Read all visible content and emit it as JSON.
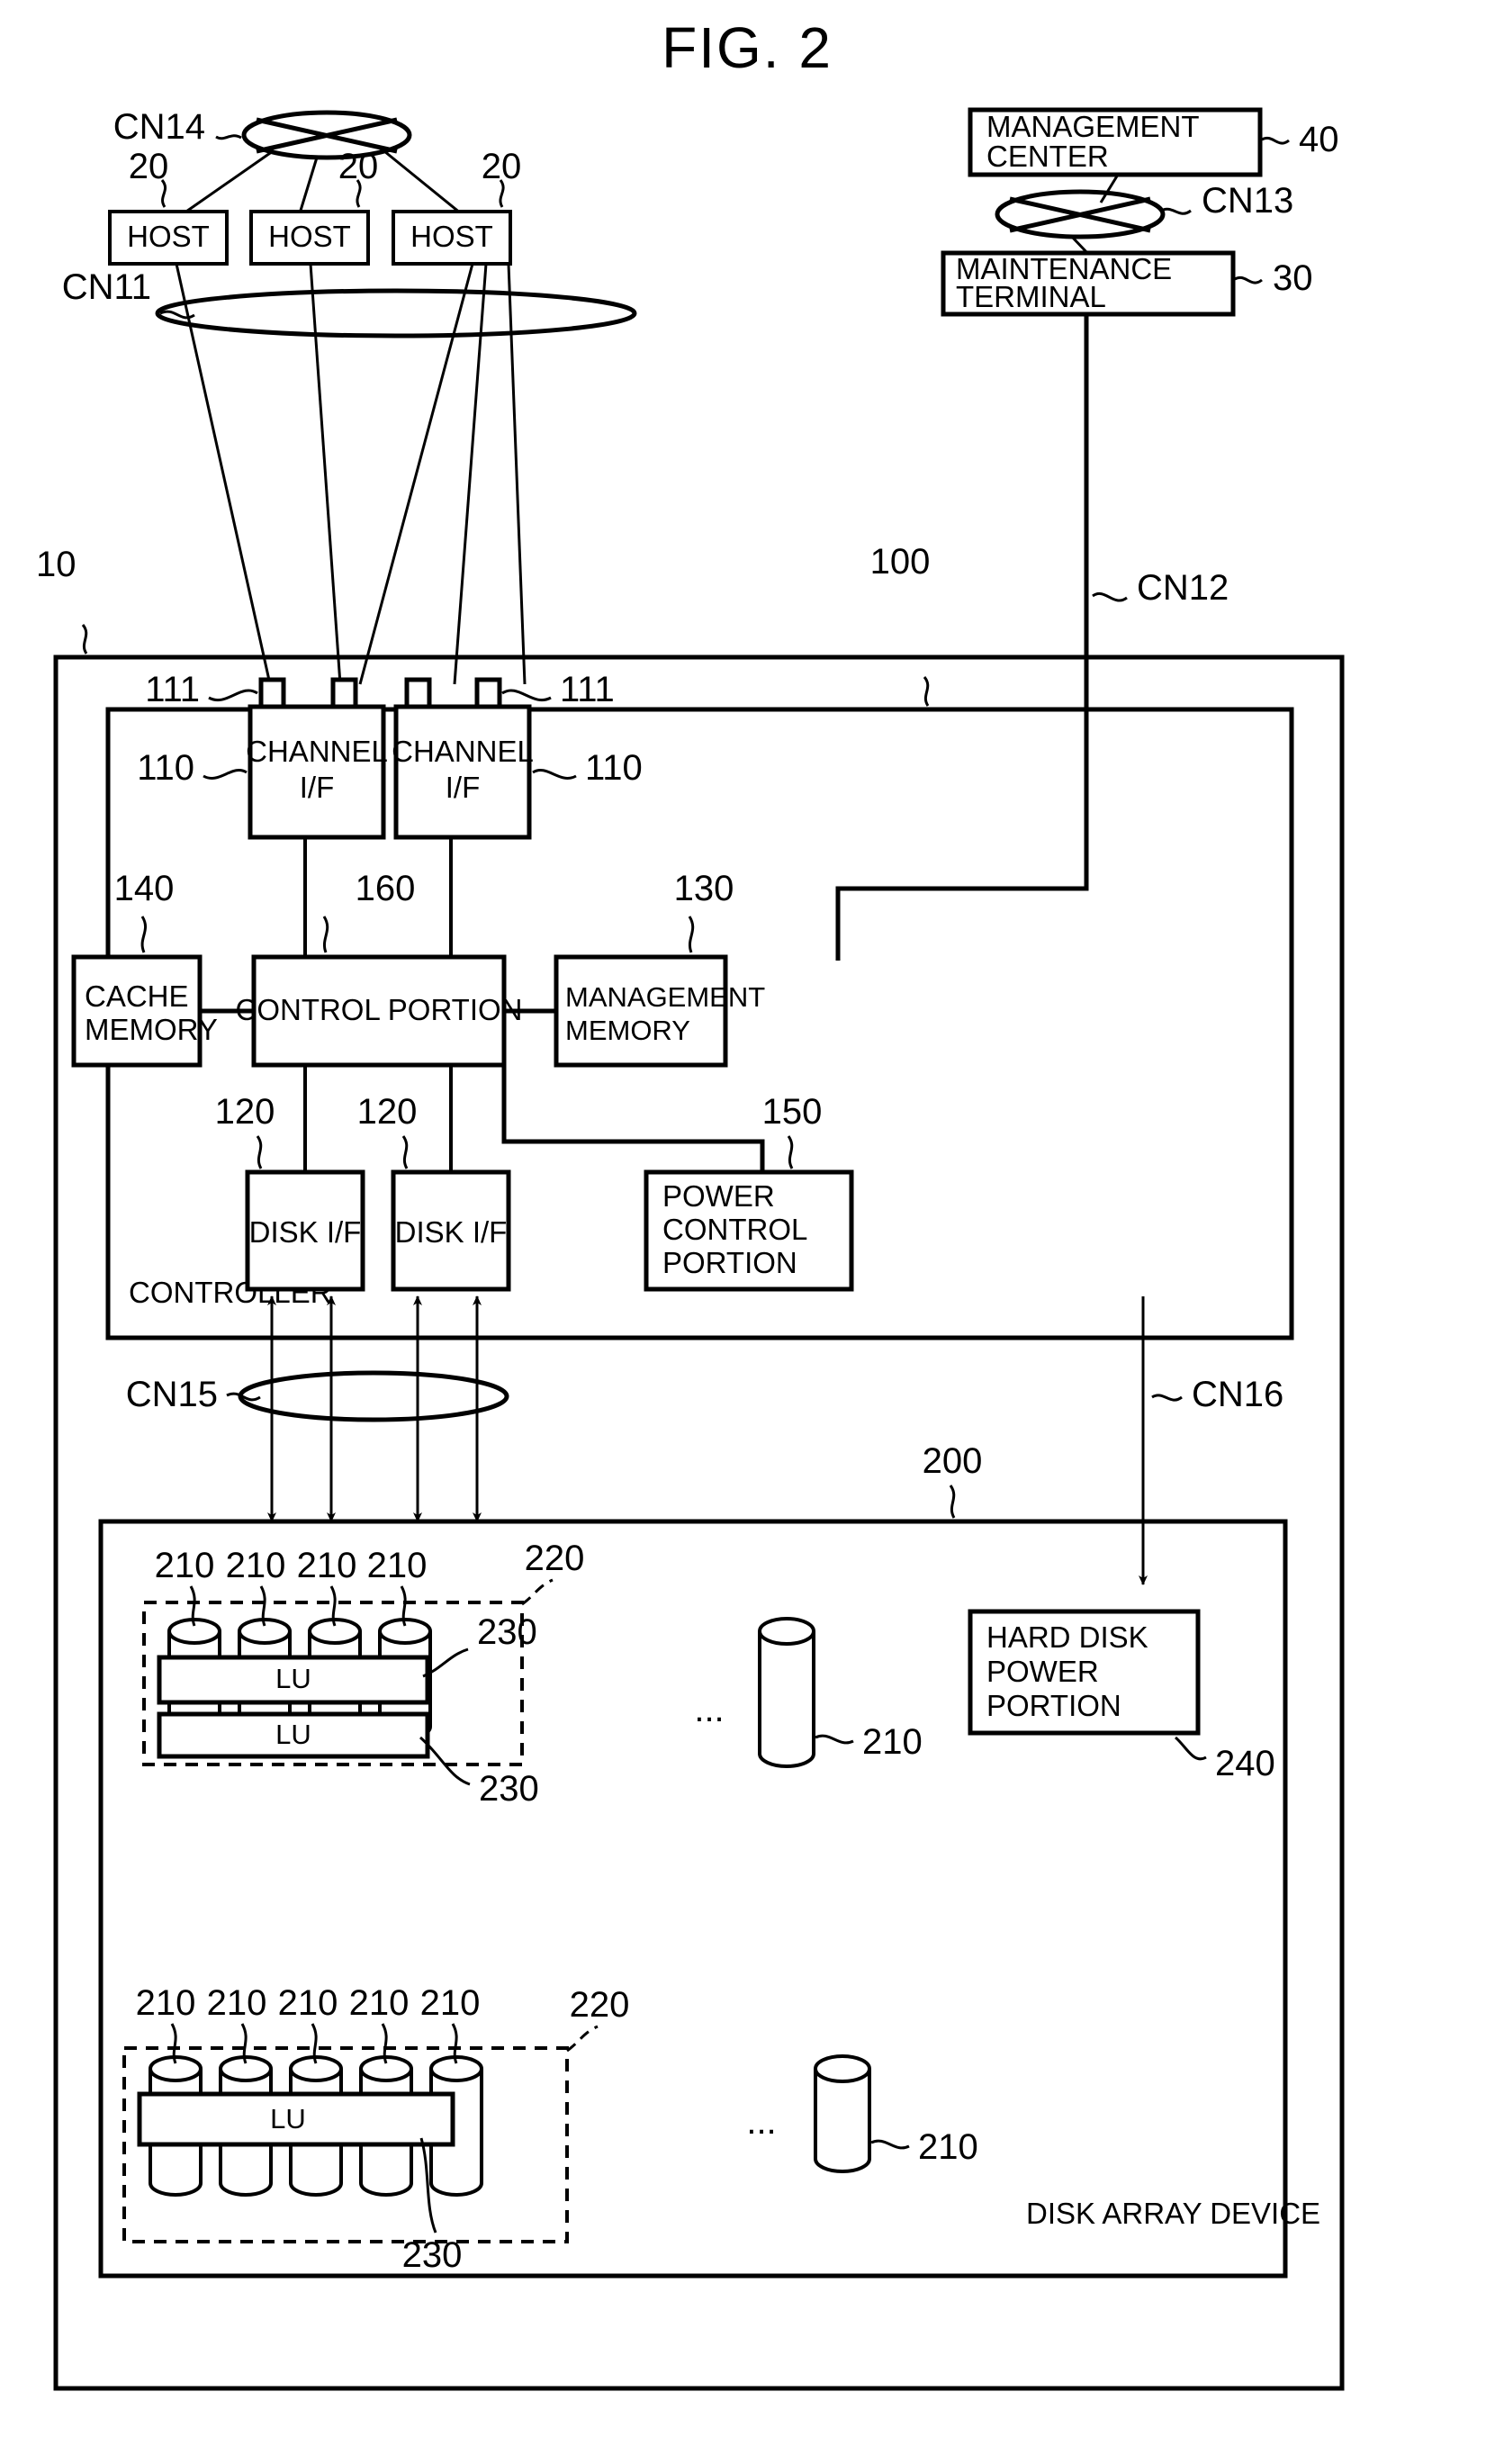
{
  "figure": {
    "title": "FIG. 2",
    "domain": "patent-diagram"
  },
  "networks": [
    {
      "id": "cn14",
      "label": "CN14"
    },
    {
      "id": "cn13",
      "label": "CN13"
    },
    {
      "id": "cn11",
      "label": "CN11"
    },
    {
      "id": "cn12",
      "label": "CN12"
    },
    {
      "id": "cn15",
      "label": "CN15"
    },
    {
      "id": "cn16",
      "label": "CN16"
    }
  ],
  "hosts": [
    {
      "label": "HOST",
      "ref": "20"
    },
    {
      "label": "HOST",
      "ref": "20"
    },
    {
      "label": "HOST",
      "ref": "20"
    }
  ],
  "management": {
    "center_label": "MANAGEMENT CENTER",
    "center_line1": "MANAGEMENT",
    "center_line2": "CENTER",
    "center_ref": "40",
    "terminal_line1": "MAINTENANCE",
    "terminal_line2": "TERMINAL",
    "terminal_ref": "30"
  },
  "system": {
    "outer_ref": "10",
    "controller_frame_ref": "100",
    "controller_label": "CONTROLLER"
  },
  "controller": {
    "channel_ifs": [
      {
        "line1": "CHANNEL",
        "line2": "I/F",
        "ref": "110",
        "port_ref": "111"
      },
      {
        "line1": "CHANNEL",
        "line2": "I/F",
        "ref": "110",
        "port_ref": "111"
      }
    ],
    "cache_memory": {
      "line1": "CACHE",
      "line2": "MEMORY",
      "ref": "140"
    },
    "control_portion": {
      "label": "CONTROL PORTION",
      "ref": "160"
    },
    "management_memory": {
      "line1": "MANAGEMENT",
      "line2": "MEMORY",
      "ref": "130"
    },
    "disk_ifs": [
      {
        "label": "DISK I/F",
        "ref": "120"
      },
      {
        "label": "DISK I/F",
        "ref": "120"
      }
    ],
    "power_control": {
      "line1": "POWER",
      "line2": "CONTROL",
      "line3": "PORTION",
      "ref": "150"
    }
  },
  "disk_array": {
    "frame_ref": "200",
    "label": "DISK ARRAY DEVICE",
    "hard_disk_power": {
      "line1": "HARD DISK",
      "line2": "POWER",
      "line3": "PORTION",
      "ref": "240"
    },
    "groups": [
      {
        "group_ref": "220",
        "disk_refs": [
          "210",
          "210",
          "210",
          "210"
        ],
        "spare_disk_ref": "210",
        "lus": [
          {
            "label": "LU",
            "ref": "230"
          },
          {
            "label": "LU",
            "ref": "230"
          }
        ],
        "ellipsis": "..."
      },
      {
        "group_ref": "220",
        "disk_refs": [
          "210",
          "210",
          "210",
          "210",
          "210"
        ],
        "spare_disk_ref": "210",
        "lus": [
          {
            "label": "LU",
            "ref": "230"
          }
        ],
        "ellipsis": "..."
      }
    ]
  }
}
